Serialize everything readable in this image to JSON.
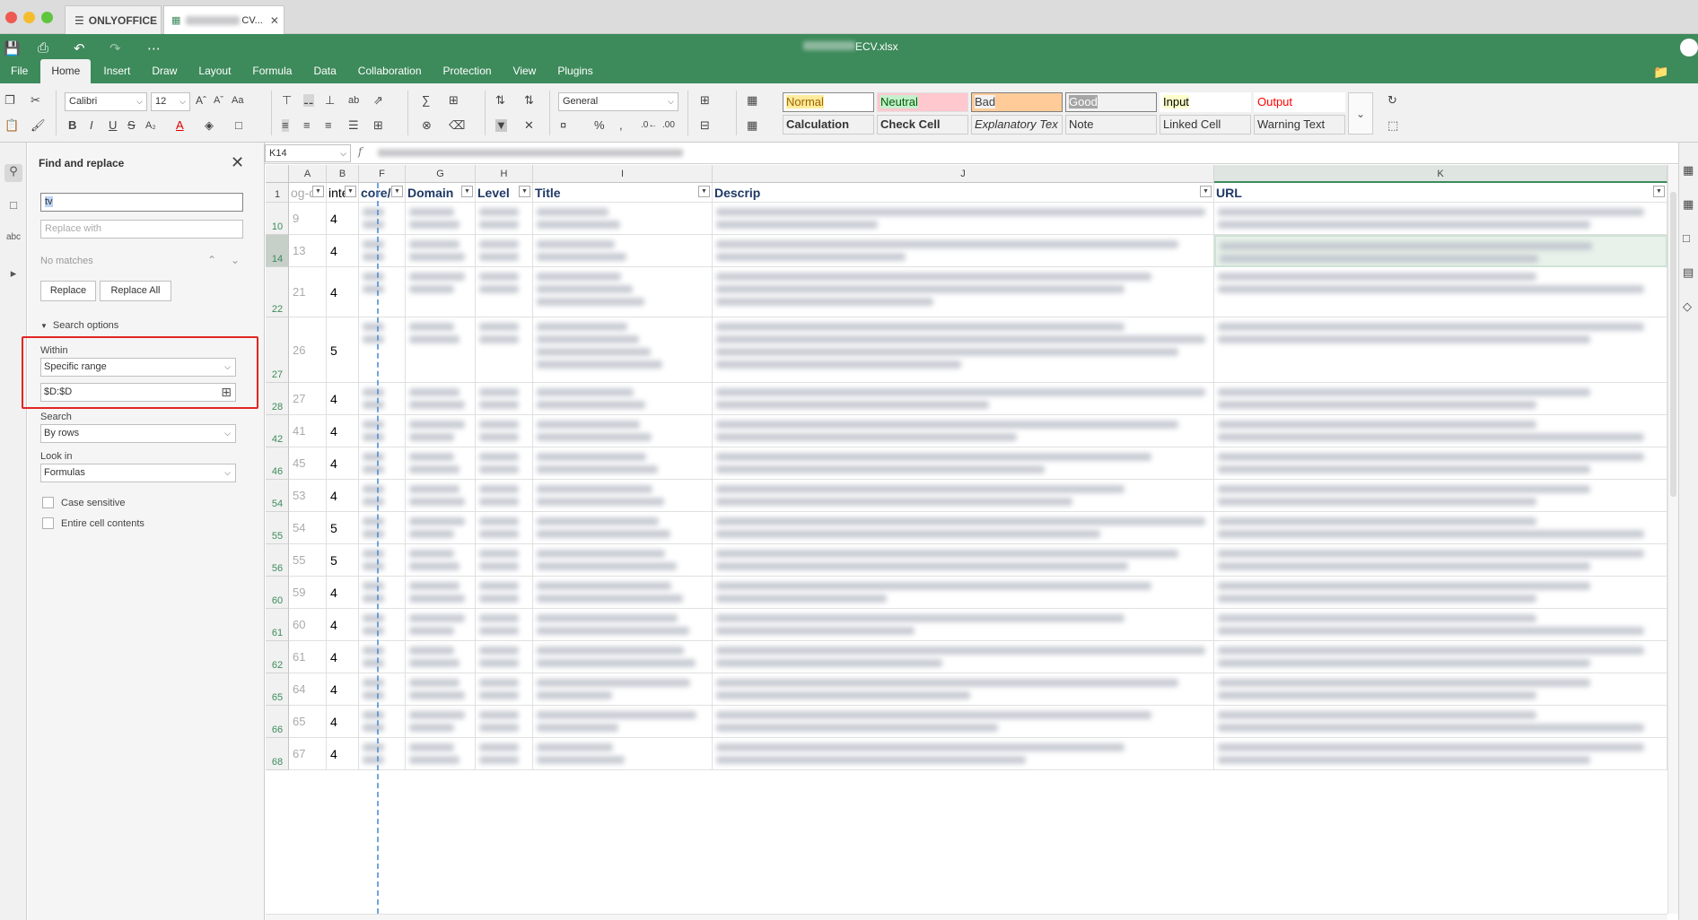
{
  "tabs": {
    "app_tab": "ONLYOFFICE",
    "doc_tab_suffix": "CV..."
  },
  "header": {
    "doc_title_suffix": "ECV.xlsx"
  },
  "menu": [
    "File",
    "Home",
    "Insert",
    "Draw",
    "Layout",
    "Formula",
    "Data",
    "Collaboration",
    "Protection",
    "View",
    "Plugins"
  ],
  "toolbar": {
    "font_name": "Calibri",
    "font_size": "12",
    "number_format": "General",
    "styles": [
      {
        "label": "Normal",
        "bg": "#ffffff",
        "color": "#000000",
        "border": "#888888"
      },
      {
        "label": "Neutral",
        "bg": "#ffeb9c",
        "color": "#9c6500",
        "border": "#e0e0e0"
      },
      {
        "label": "Bad",
        "bg": "#ffc7ce",
        "color": "#9c0006",
        "border": "#e0e0e0"
      },
      {
        "label": "Good",
        "bg": "#c6efce",
        "color": "#006100",
        "border": "#e0e0e0"
      },
      {
        "label": "Input",
        "bg": "#ffcc99",
        "color": "#3f3f76",
        "border": "#7f7f7f"
      },
      {
        "label": "Output",
        "bg": "#f2f2f2",
        "color": "#3f3f3f",
        "border": "#3f3f3f"
      },
      {
        "label": "Calculation",
        "bg": "#f2f2f2",
        "color": "#fa7d00",
        "border": "#7f7f7f"
      },
      {
        "label": "Check Cell",
        "bg": "#a5a5a5",
        "color": "#ffffff",
        "border": "#3f3f3f"
      },
      {
        "label": "Explanatory Tex",
        "bg": "#ffffff",
        "color": "#7f7f7f",
        "border": "#ffffff"
      },
      {
        "label": "Note",
        "bg": "#ffffcc",
        "color": "#000000",
        "border": "#b2b2b2"
      },
      {
        "label": "Linked Cell",
        "bg": "#ffffff",
        "color": "#fa7d00",
        "border": "#ffffff"
      },
      {
        "label": "Warning Text",
        "bg": "#ffffff",
        "color": "#ff0000",
        "border": "#ffffff"
      }
    ]
  },
  "formula_bar": {
    "name_box": "K14",
    "fx": "f"
  },
  "find_replace": {
    "title": "Find and replace",
    "find_value": "tv",
    "replace_placeholder": "Replace with",
    "status": "No matches",
    "replace_label": "Replace",
    "replace_all_label": "Replace All",
    "search_options_label": "Search options",
    "within_label": "Within",
    "within_value": "Specific range",
    "range_value": "$D:$D",
    "search_label": "Search",
    "search_value": "By rows",
    "look_in_label": "Look in",
    "look_in_value": "Formulas",
    "case_sensitive_label": "Case sensitive",
    "entire_cell_label": "Entire cell contents"
  },
  "sheet": {
    "columns": [
      "A",
      "B",
      "F",
      "G",
      "H",
      "I",
      "J",
      "K"
    ],
    "headers": {
      "A": "og-de",
      "B": "inte",
      "F": "core/el",
      "G": "Domain",
      "H": "Level",
      "I": "Title",
      "J": "Descrip",
      "K": "URL"
    },
    "rows": [
      {
        "num": "10",
        "a": "9",
        "b": "4"
      },
      {
        "num": "14",
        "a": "13",
        "b": "4"
      },
      {
        "num": "22",
        "a": "21",
        "b": "4"
      },
      {
        "num": "27",
        "a": "26",
        "b": "5"
      },
      {
        "num": "28",
        "a": "27",
        "b": "4"
      },
      {
        "num": "42",
        "a": "41",
        "b": "4"
      },
      {
        "num": "46",
        "a": "45",
        "b": "4"
      },
      {
        "num": "54",
        "a": "53",
        "b": "4"
      },
      {
        "num": "55",
        "a": "54",
        "b": "5"
      },
      {
        "num": "56",
        "a": "55",
        "b": "5"
      },
      {
        "num": "60",
        "a": "59",
        "b": "4"
      },
      {
        "num": "61",
        "a": "60",
        "b": "4"
      },
      {
        "num": "62",
        "a": "61",
        "b": "4"
      },
      {
        "num": "65",
        "a": "64",
        "b": "4"
      },
      {
        "num": "66",
        "a": "65",
        "b": "4"
      },
      {
        "num": "68",
        "a": "67",
        "b": "4"
      }
    ],
    "header_row_num": "1",
    "selected_row": "14",
    "selected_col": "K"
  }
}
